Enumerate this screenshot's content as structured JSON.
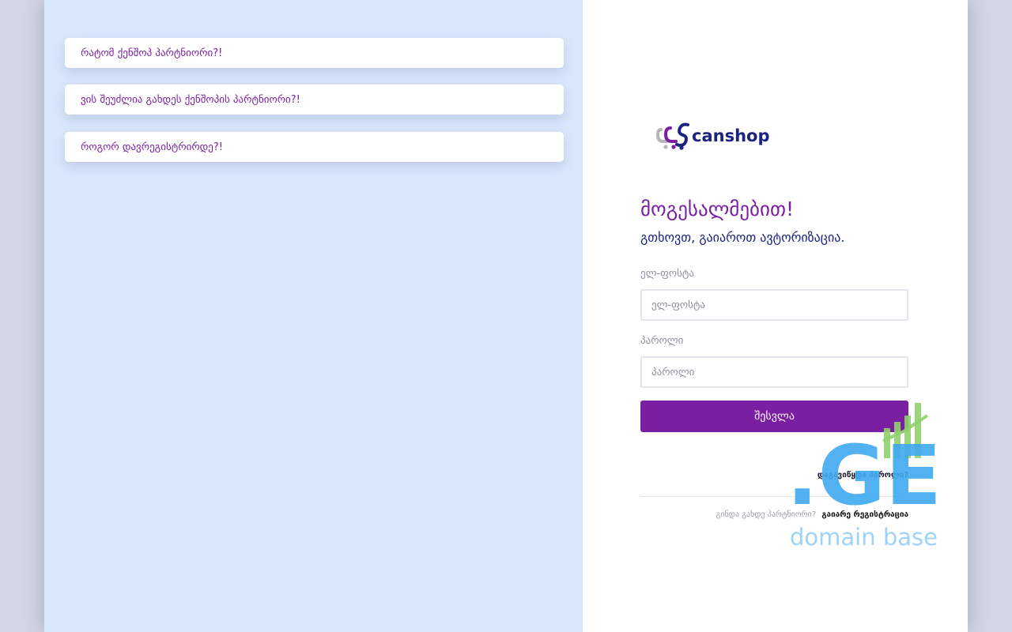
{
  "faq": [
    {
      "label": "რატომ ქენშოპ პარტნიორი?!"
    },
    {
      "label": "ვის შეუძლია გახდეს ქენშოპის პარტნიორი?!"
    },
    {
      "label": "როგორ დავრეგისტრირდე?!"
    }
  ],
  "brand": {
    "logo_text": "canshop",
    "purple": "#7b1fa2",
    "navy": "#1a237e",
    "grey": "#b6b6b6"
  },
  "login": {
    "welcome": "მოგესალმებით!",
    "subtitle": "გთხოვთ, გაიაროთ ავტორიზაცია.",
    "email_label": "ელ-ფოსტა",
    "email_placeholder": "ელ-ფოსტა",
    "password_label": "პაროლი",
    "password_placeholder": "პაროლი",
    "submit_label": "შესვლა",
    "forgot_label": "დაგავიწყდა პაროლი?",
    "partner_question": "გინდა გახდე პარტნიორი?",
    "register_label": "გაიარე რეგისტრაცია"
  },
  "watermark": {
    "mark_text": ".GE",
    "caption": "domain base",
    "blue": "#3fa9f0",
    "green": "#8fd16a"
  }
}
